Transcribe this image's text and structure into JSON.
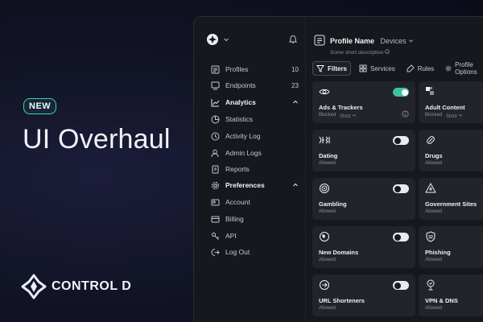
{
  "hero": {
    "badge": "NEW",
    "title": "UI Overhaul",
    "brand": "CONTROL D"
  },
  "sidebar": {
    "items": [
      {
        "label": "Profiles",
        "count": "10",
        "icon": "profiles-icon"
      },
      {
        "label": "Endpoints",
        "count": "23",
        "icon": "endpoints-icon"
      },
      {
        "label": "Analytics",
        "icon": "analytics-icon",
        "section": true,
        "expanded": true
      },
      {
        "label": "Statistics",
        "icon": "statistics-icon"
      },
      {
        "label": "Activity Log",
        "icon": "activity-log-icon"
      },
      {
        "label": "Admin Logs",
        "icon": "admin-logs-icon"
      },
      {
        "label": "Reports",
        "icon": "reports-icon"
      },
      {
        "label": "Preferences",
        "icon": "gear-icon",
        "section": true,
        "expanded": true
      },
      {
        "label": "Account",
        "icon": "account-icon"
      },
      {
        "label": "Billing",
        "icon": "billing-icon"
      },
      {
        "label": "API",
        "icon": "api-icon"
      },
      {
        "label": "Log Out",
        "icon": "logout-icon"
      }
    ]
  },
  "profile_header": {
    "name": "Profile Name",
    "devices": "Devices",
    "description": "Some short description"
  },
  "tabs": [
    {
      "label": "Filters",
      "active": true,
      "icon": "filter-icon"
    },
    {
      "label": "Services",
      "icon": "services-icon"
    },
    {
      "label": "Rules",
      "icon": "rules-icon"
    },
    {
      "label": "Profile Options",
      "icon": "profile-options-icon"
    }
  ],
  "filters": [
    {
      "title": "Ads & Trackers",
      "status": "Blocked",
      "mode": "Strict",
      "toggle": "on",
      "icon": "eye-icon"
    },
    {
      "title": "Adult Content",
      "status": "Blocked",
      "mode": "Strict",
      "icon": "adult-content-icon"
    },
    {
      "title": "Dating",
      "status": "Allowed",
      "toggle": "off",
      "icon": "dating-icon"
    },
    {
      "title": "Drugs",
      "status": "Allowed",
      "icon": "drugs-icon"
    },
    {
      "title": "Gambling",
      "status": "Allowed",
      "toggle": "off",
      "icon": "gambling-icon"
    },
    {
      "title": "Government Sites",
      "status": "Allowed",
      "icon": "government-icon"
    },
    {
      "title": "New Domains",
      "status": "Allowed",
      "toggle": "off",
      "icon": "new-domains-icon"
    },
    {
      "title": "Phishing",
      "status": "Allowed",
      "icon": "phishing-icon"
    },
    {
      "title": "URL Shorteners",
      "status": "Allowed",
      "toggle": "off",
      "icon": "url-shortener-icon"
    },
    {
      "title": "VPN & DNS",
      "status": "Allowed",
      "icon": "vpn-dns-icon"
    }
  ],
  "colors": {
    "accent": "#35d6a8",
    "toggle_on": "#3cc49a",
    "card_bg": "#22242b",
    "window_bg": "#17181d"
  }
}
